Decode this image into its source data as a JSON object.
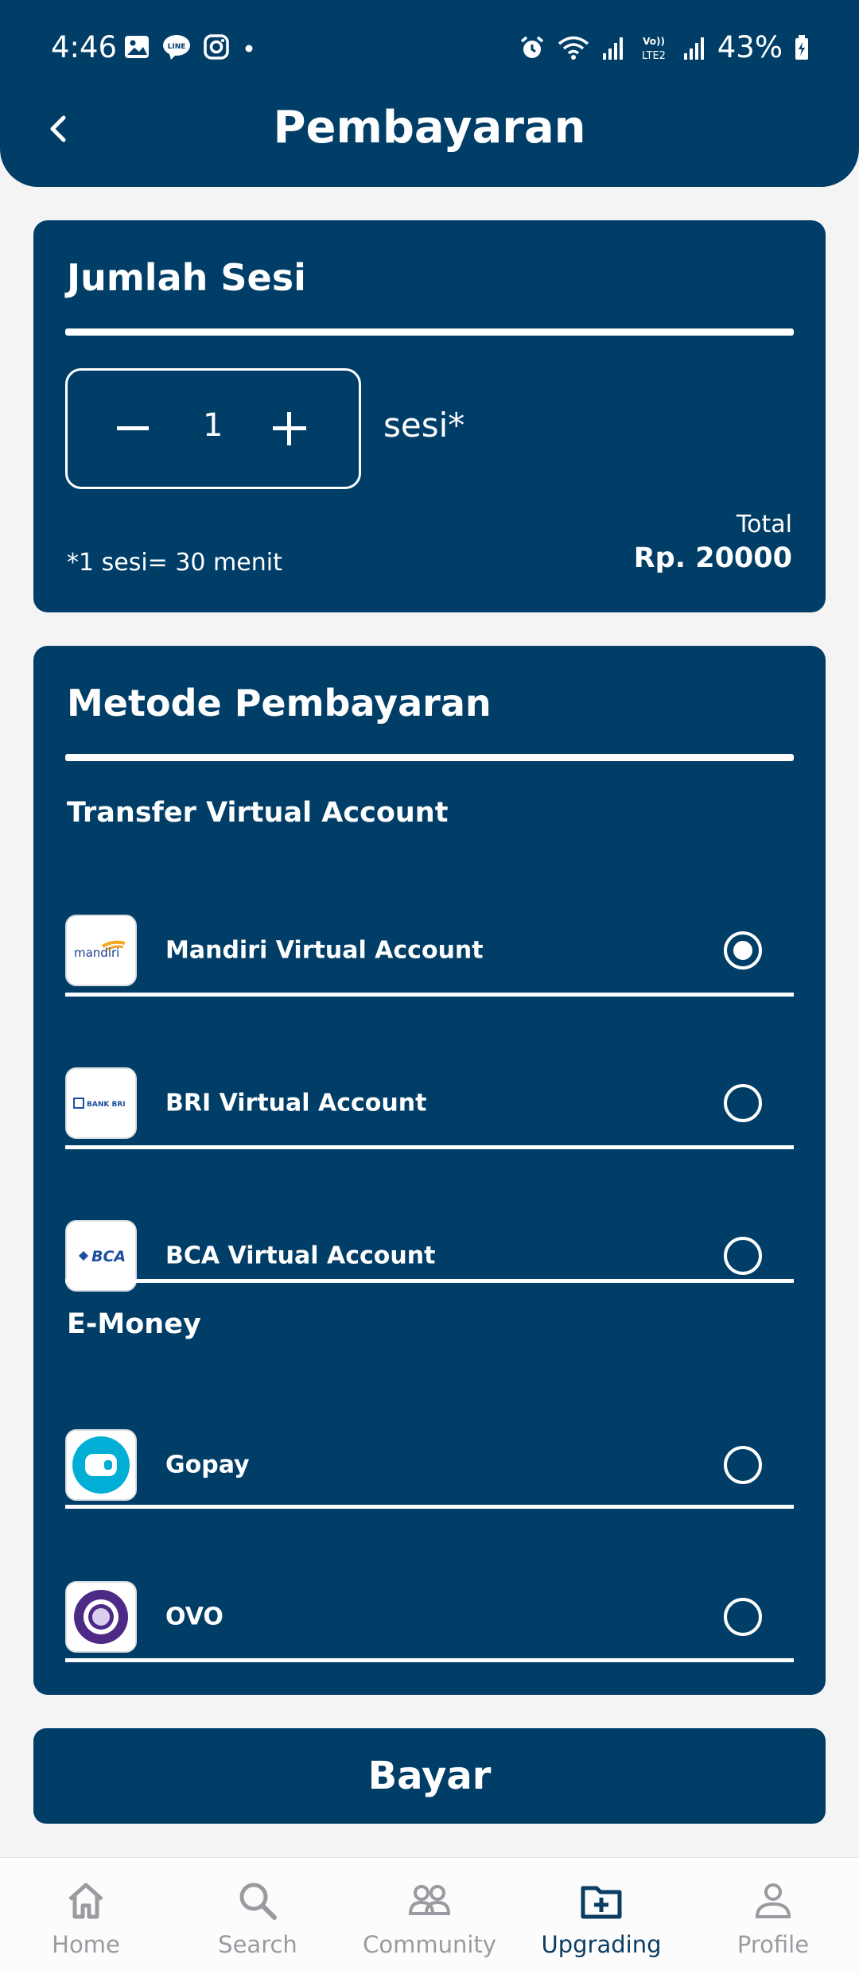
{
  "status_bar": {
    "time": "4:46",
    "battery": "43%",
    "network": "LTE2"
  },
  "header": {
    "title": "Pembayaran",
    "back_icon": "chevron-left-icon"
  },
  "session_card": {
    "title": "Jumlah Sesi",
    "quantity": "1",
    "unit": "sesi*",
    "note": "*1 sesi= 30 menit",
    "total_label": "Total",
    "total_value": "Rp. 20000"
  },
  "payment_card": {
    "title": "Metode Pembayaran",
    "sections": [
      {
        "label": "Transfer Virtual Account",
        "options": [
          {
            "name": "Mandiri Virtual Account",
            "logo": "mandiri-logo",
            "logo_text": "mandiri",
            "selected": true
          },
          {
            "name": "BRI Virtual Account",
            "logo": "bri-logo",
            "logo_text": "BANK BRI",
            "selected": false
          },
          {
            "name": "BCA Virtual Account",
            "logo": "bca-logo",
            "logo_text": "BCA",
            "selected": false
          }
        ]
      },
      {
        "label": "E-Money",
        "options": [
          {
            "name": "Gopay",
            "logo": "gopay-logo",
            "selected": false
          },
          {
            "name": "OVO",
            "logo": "ovo-logo",
            "selected": false
          }
        ]
      }
    ]
  },
  "pay_button": {
    "label": "Bayar"
  },
  "bottom_nav": {
    "items": [
      {
        "label": "Home",
        "icon": "home-icon",
        "active": false
      },
      {
        "label": "Search",
        "icon": "search-icon",
        "active": false
      },
      {
        "label": "Community",
        "icon": "community-icon",
        "active": false
      },
      {
        "label": "Upgrading",
        "icon": "folder-plus-icon",
        "active": true
      },
      {
        "label": "Profile",
        "icon": "profile-icon",
        "active": false
      }
    ]
  },
  "colors": {
    "primary": "#003e68",
    "background": "#f4f4f5",
    "nav_inactive": "#9a9aa0",
    "nav_active": "#0b3d63"
  }
}
